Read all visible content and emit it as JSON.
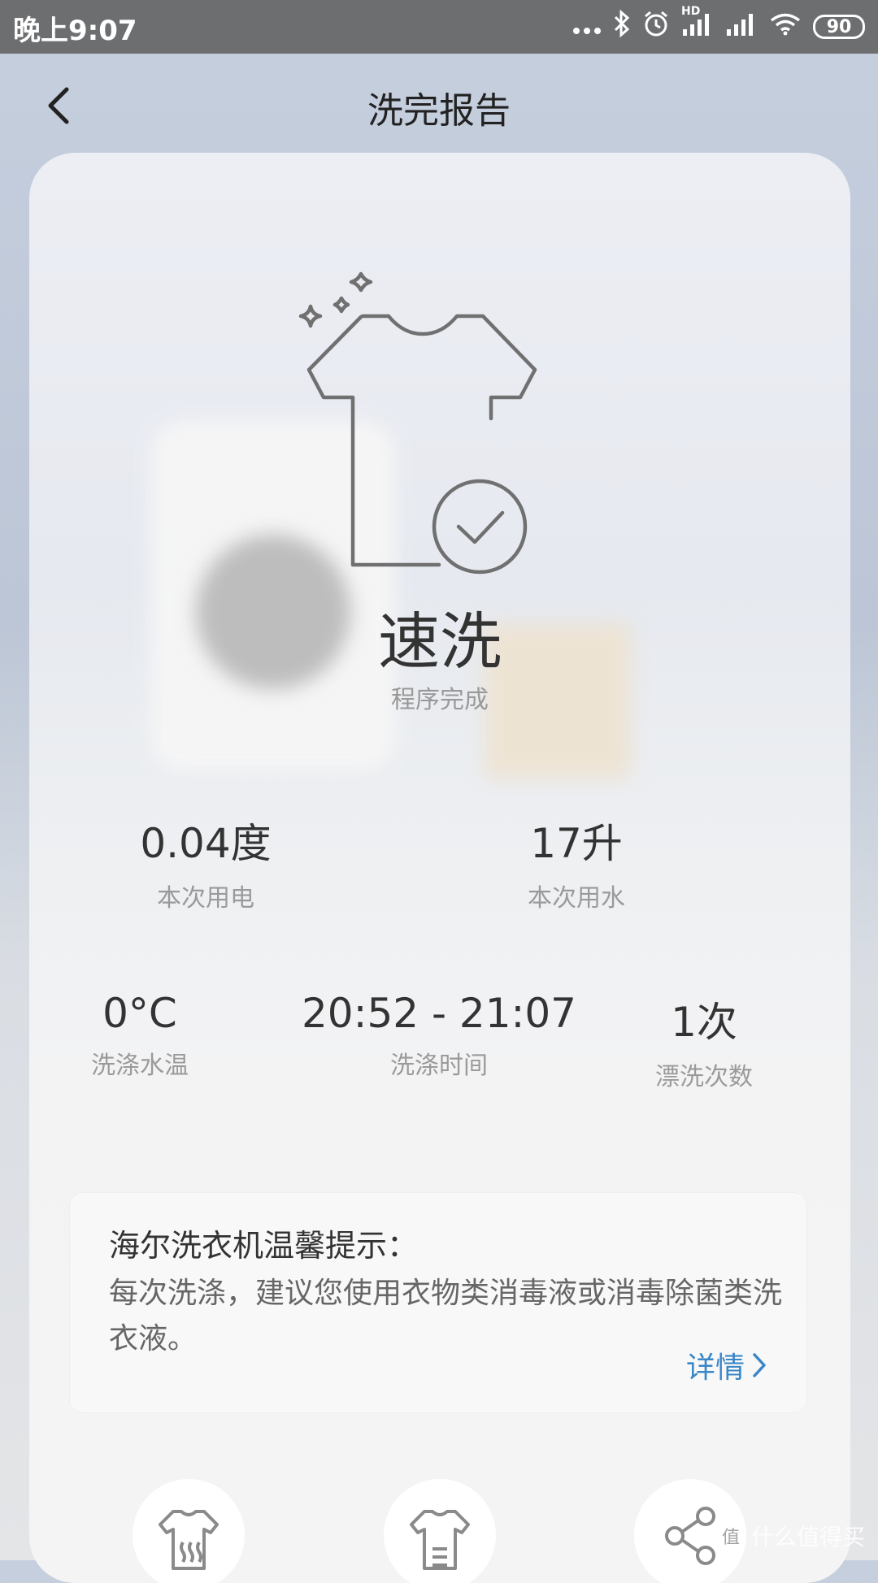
{
  "status_bar": {
    "time": "晚上9:07",
    "signal_hd": "HD",
    "battery": "90"
  },
  "header": {
    "title": "洗完报告"
  },
  "program": {
    "name": "速洗",
    "status": "程序完成"
  },
  "stats_top": [
    {
      "value": "0.04度",
      "label": "本次用电"
    },
    {
      "value": "17升",
      "label": "本次用水"
    }
  ],
  "stats_bottom": [
    {
      "value": "0°C",
      "label": "洗涤水温"
    },
    {
      "value": "20:52 - 21:07",
      "label": "洗涤时间"
    },
    {
      "value": "1次",
      "label": "漂洗次数"
    }
  ],
  "tip": {
    "title": "海尔洗衣机温馨提示：",
    "body": "每次洗涤，建议您使用衣物类消毒液或消毒除菌类洗衣液。",
    "link": "详情"
  },
  "watermark": {
    "badge": "值",
    "text": "什么值得买"
  },
  "colors": {
    "accent": "#3a86c8",
    "icon_stroke": "#707070"
  }
}
